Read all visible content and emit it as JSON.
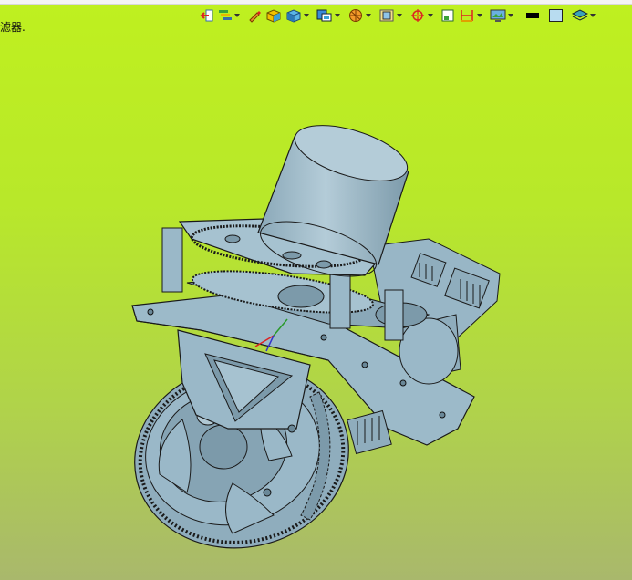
{
  "status": {
    "left_label": "滤器."
  },
  "toolbar": {
    "items": [
      {
        "icon": "exit-sketch-icon",
        "has_dropdown": false
      },
      {
        "icon": "display-settings-icon",
        "has_dropdown": true
      },
      {
        "icon": "pencil-icon",
        "has_dropdown": false
      },
      {
        "icon": "box-yellow-icon",
        "has_dropdown": false
      },
      {
        "icon": "box-blue-icon",
        "has_dropdown": true
      },
      {
        "icon": "view-orientation-icon",
        "has_dropdown": true
      },
      {
        "icon": "section-view-icon",
        "has_dropdown": true
      },
      {
        "icon": "zoom-frame-icon",
        "has_dropdown": true
      },
      {
        "icon": "target-icon",
        "has_dropdown": true
      },
      {
        "icon": "single-view-icon",
        "has_dropdown": false
      },
      {
        "icon": "dimension-icon",
        "has_dropdown": true
      },
      {
        "icon": "monitor-icon",
        "has_dropdown": true
      },
      {
        "icon": "black-fill-icon",
        "has_dropdown": false
      },
      {
        "icon": "light-blue-square-icon",
        "has_dropdown": false
      },
      {
        "icon": "layers-icon",
        "has_dropdown": true
      }
    ]
  },
  "viewport": {
    "background_top": "#bff01f",
    "background_bottom": "#a9b86c",
    "model_color": "#9ab8c8",
    "model_dark": "#7a98a8",
    "edge_color": "#1a1a1a"
  }
}
